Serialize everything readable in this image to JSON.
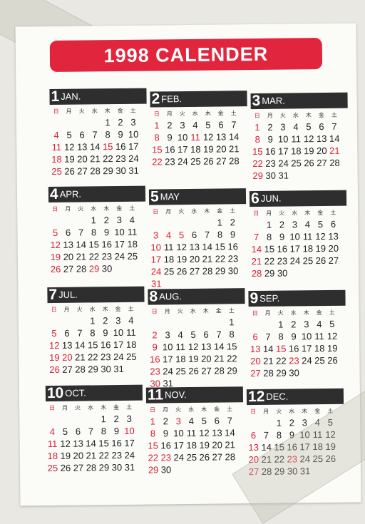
{
  "title": "1998 CALENDER",
  "weekdays": [
    "日",
    "月",
    "火",
    "水",
    "木",
    "金",
    "土"
  ],
  "months": [
    {
      "num": "1",
      "name": "JAN.",
      "start": 4,
      "days": 31,
      "holidays": [
        15
      ]
    },
    {
      "num": "2",
      "name": "FEB.",
      "start": 0,
      "days": 28,
      "holidays": [
        11
      ]
    },
    {
      "num": "3",
      "name": "MAR.",
      "start": 0,
      "days": 31,
      "holidays": [
        21
      ]
    },
    {
      "num": "4",
      "name": "APR.",
      "start": 3,
      "days": 30,
      "holidays": [
        29
      ]
    },
    {
      "num": "5",
      "name": "MAY",
      "start": 5,
      "days": 31,
      "holidays": [
        3,
        4,
        5
      ]
    },
    {
      "num": "6",
      "name": "JUN.",
      "start": 1,
      "days": 30,
      "holidays": []
    },
    {
      "num": "7",
      "name": "JUL.",
      "start": 3,
      "days": 31,
      "holidays": [
        20
      ]
    },
    {
      "num": "8",
      "name": "AUG.",
      "start": 6,
      "days": 31,
      "holidays": []
    },
    {
      "num": "9",
      "name": "SEP.",
      "start": 2,
      "days": 30,
      "holidays": [
        15,
        23
      ]
    },
    {
      "num": "10",
      "name": "OCT.",
      "start": 4,
      "days": 31,
      "holidays": [
        10
      ]
    },
    {
      "num": "11",
      "name": "NOV.",
      "start": 0,
      "days": 30,
      "holidays": [
        3,
        23
      ]
    },
    {
      "num": "12",
      "name": "DEC.",
      "start": 2,
      "days": 31,
      "holidays": [
        23
      ]
    }
  ],
  "colors": {
    "accent": "#e0253d",
    "header_bar": "#2e2e2e",
    "holiday": "#d81f36"
  }
}
